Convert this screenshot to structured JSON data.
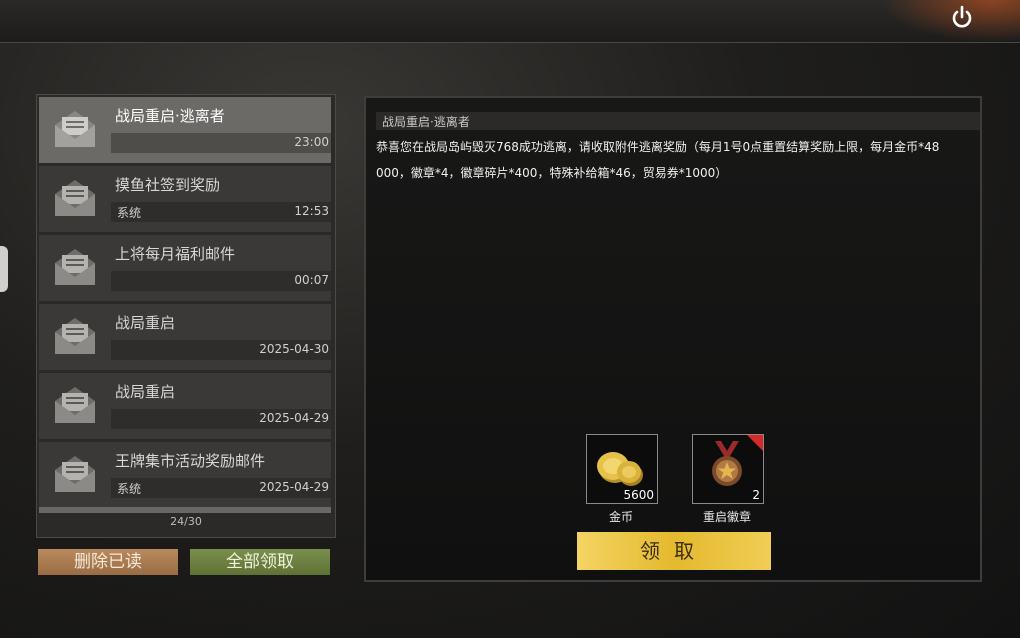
{
  "mails": [
    {
      "title": "战局重启·逃离者",
      "sender": "",
      "time": "23:00",
      "selected": true
    },
    {
      "title": "摸鱼社签到奖励",
      "sender": "系统",
      "time": "12:53",
      "selected": false
    },
    {
      "title": "上将每月福利邮件",
      "sender": "",
      "time": "00:07",
      "selected": false
    },
    {
      "title": "战局重启",
      "sender": "",
      "time": "2025-04-30",
      "selected": false
    },
    {
      "title": "战局重启",
      "sender": "",
      "time": "2025-04-29",
      "selected": false
    },
    {
      "title": "王牌集市活动奖励邮件",
      "sender": "系统",
      "time": "2025-04-29",
      "selected": false
    }
  ],
  "mail_count": "24/30",
  "buttons": {
    "delete_read": "删除已读",
    "claim_all": "全部领取",
    "claim": "领取"
  },
  "detail": {
    "title": "战局重启·逃离者",
    "body_line1": "恭喜您在战局岛屿毁灭768成功逃离，请收取附件逃离奖励（每月1号0点重置结算奖励上限，每月金币*48",
    "body_line2": "000，徽章*4，徽章碎片*400，特殊补给箱*46，贸易券*1000）"
  },
  "rewards": [
    {
      "name": "金币",
      "qty": "5600",
      "icon": "gold-coins-icon"
    },
    {
      "name": "重启徽章",
      "qty": "2",
      "icon": "medal-icon"
    }
  ],
  "colors": {
    "claim": "#e8c23e",
    "delete": "#a97a52",
    "claim_all": "#6c8040"
  }
}
